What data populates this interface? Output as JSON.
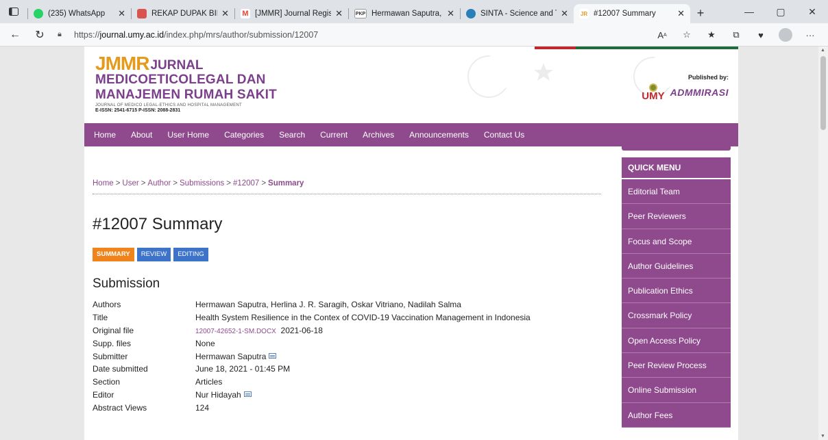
{
  "browser": {
    "tabs": [
      {
        "title": "(235) WhatsApp",
        "fav_color": "#25d366",
        "icon": "whatsapp-icon"
      },
      {
        "title": "REKAP DUPAK BIDANG",
        "fav_color": "#d9534f",
        "icon": "pdf-icon"
      },
      {
        "title": "[JMMR] Journal Regist",
        "fav_color": "#ea4335",
        "icon": "gmail-icon"
      },
      {
        "title": "Hermawan Saputra, Do",
        "fav_color": "#333333",
        "icon": "pkp-icon"
      },
      {
        "title": "SINTA - Science and Te",
        "fav_color": "#2a7fb8",
        "icon": "sinta-icon"
      },
      {
        "title": "#12007 Summary",
        "fav_color": "#e59a1b",
        "icon": "jmmr-icon"
      }
    ],
    "url_prefix": "https://",
    "url_host": "journal.umy.ac.id",
    "url_path": "/index.php/mrs/author/submission/12007"
  },
  "header": {
    "logo_jmmr": "JMMR",
    "logo_jurnal": "JURNAL",
    "logo_line2": "MEDICOETICOLEGAL DAN",
    "logo_line3": "MANAJEMEN RUMAH SAKIT",
    "logo_sub": "JOURNAL OF MEDICO LEGAL-ETHICS AND HOSPITAL MANAGEMENT",
    "logo_issn": "E-ISSN: 2541-6715  P-ISSN: 2088-2831",
    "published_by": "Published by:",
    "umy": "UMY",
    "admmirasi": "ADMMIRASI"
  },
  "nav": [
    "Home",
    "About",
    "User Home",
    "Categories",
    "Search",
    "Current",
    "Archives",
    "Announcements",
    "Contact Us"
  ],
  "breadcrumb": [
    "Home",
    "User",
    "Author",
    "Submissions",
    "#12007",
    "Summary"
  ],
  "page_title": "#12007 Summary",
  "subtabs": [
    "SUMMARY",
    "REVIEW",
    "EDITING"
  ],
  "section_title": "Submission",
  "meta": {
    "authors_k": "Authors",
    "authors_v": "Hermawan Saputra, Herlina J. R. Saragih, Oskar Vitriano, Nadilah Salma",
    "title_k": "Title",
    "title_v": "Health System Resilience in the Contex of COVID-19 Vaccination Management in Indonesia",
    "orig_k": "Original file",
    "orig_link": "12007-42652-1-SM.DOCX",
    "orig_date": "2021-06-18",
    "supp_k": "Supp. files",
    "supp_v": "None",
    "submitter_k": "Submitter",
    "submitter_v": "Hermawan Saputra",
    "date_k": "Date submitted",
    "date_v": "June 18, 2021 - 01:45 PM",
    "section_k": "Section",
    "section_v": "Articles",
    "editor_k": "Editor",
    "editor_v": "Nur Hidayah",
    "views_k": "Abstract Views",
    "views_v": "124"
  },
  "quick_menu": {
    "title": "QUICK MENU",
    "items": [
      "Editorial Team",
      "Peer Reviewers",
      "Focus and Scope",
      "Author Guidelines",
      "Publication Ethics",
      "Crossmark Policy",
      "Open Access Policy",
      "Peer Review Process",
      "Online Submission",
      "Author Fees"
    ]
  },
  "colors": {
    "brand_purple": "#8e4a8d",
    "brand_orange": "#e59a1b",
    "tab_active": "#f0841c",
    "tab_inactive": "#3d73c9"
  }
}
